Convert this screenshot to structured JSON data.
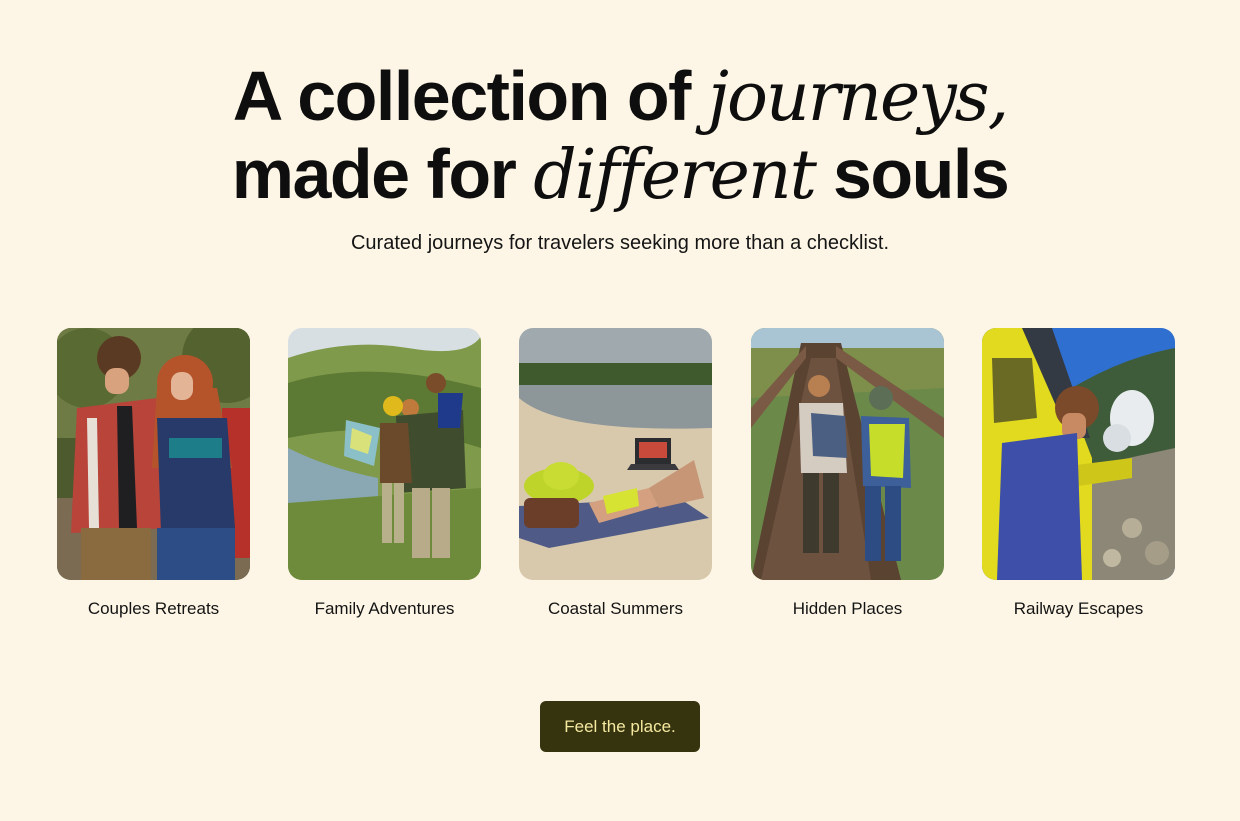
{
  "hero": {
    "title_part1": "A collection of ",
    "title_em1": "journeys,",
    "title_part2": "made for ",
    "title_em2": "different",
    "title_part3": " souls",
    "subtitle": "Curated journeys for travelers seeking more than a checklist."
  },
  "cards": [
    {
      "label": "Couples Retreats",
      "photo": "couple-portrait-photo"
    },
    {
      "label": "Family Adventures",
      "photo": "family-hiking-map-photo"
    },
    {
      "label": "Coastal Summers",
      "photo": "beach-laptop-photo"
    },
    {
      "label": "Hidden Places",
      "photo": "kids-boardwalk-photo"
    },
    {
      "label": "Railway Escapes",
      "photo": "train-window-photo"
    }
  ],
  "cta": {
    "label": "Feel the place."
  },
  "colors": {
    "background": "#fdf6e6",
    "cta_background": "#36330f",
    "cta_text": "#f5e9a0"
  }
}
